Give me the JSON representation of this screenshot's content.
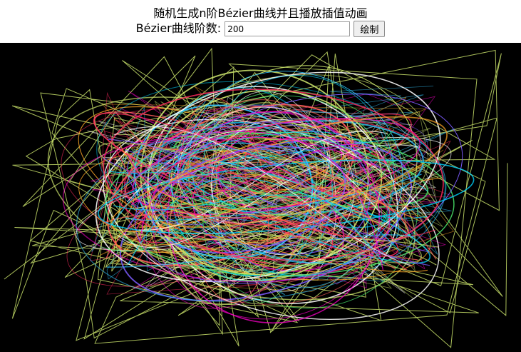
{
  "page": {
    "title": "随机生成n阶Bézier曲线并且播放插值动画"
  },
  "controls": {
    "order_label": "Bézier曲线阶数:",
    "order_value": "200",
    "draw_button_label": "绘制"
  },
  "canvas": {
    "background": "#000000",
    "polyline_color": "#c8e06a",
    "palette": [
      "#ff2a5e",
      "#ff00cc",
      "#33c6ff",
      "#ffffff",
      "#c8e06a",
      "#ffa726",
      "#7d5cff",
      "#49e66b",
      "#ff5c5c",
      "#00d4ff"
    ]
  }
}
